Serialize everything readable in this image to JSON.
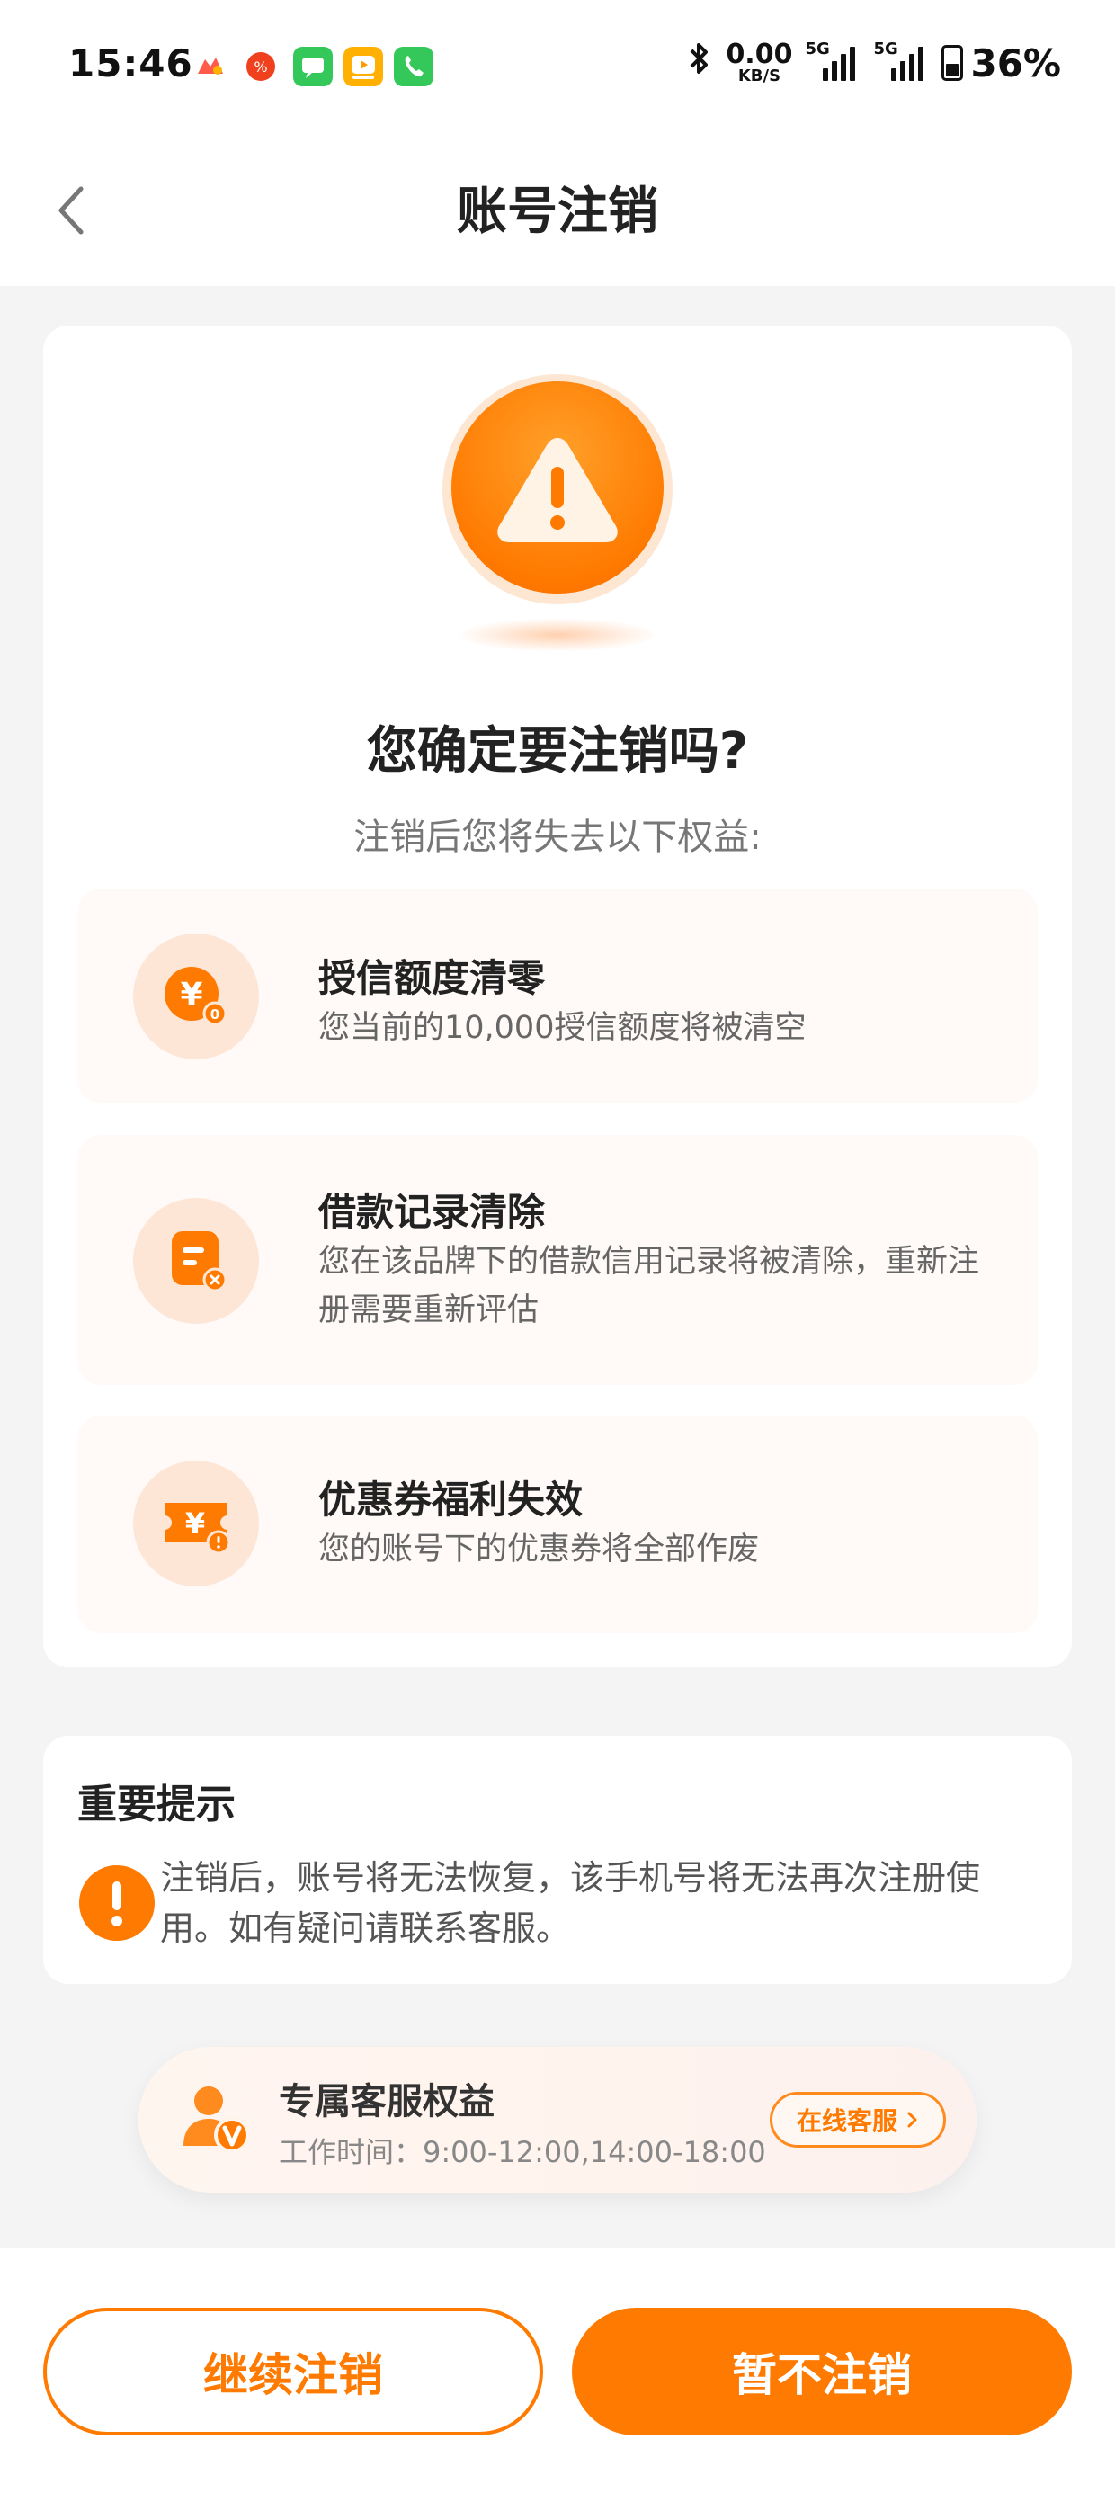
{
  "status_bar": {
    "time": "15:46",
    "net_speed_value": "0.00",
    "net_speed_unit": "KB/S",
    "signal_1_label": "5G",
    "signal_2_label": "5G",
    "battery_percent": "36%",
    "app_icons": [
      "game-icon",
      "promo-icon",
      "message-icon",
      "video-icon",
      "phone-icon"
    ],
    "bluetooth_icon": "bluetooth-icon"
  },
  "header": {
    "title": "账号注销",
    "back_icon": "chevron-left-icon"
  },
  "confirm": {
    "title": "您确定要注销吗?",
    "subtitle": "注销后您将失去以下权益:"
  },
  "benefits": [
    {
      "icon": "yen-coin-icon",
      "title": "授信额度清零",
      "desc": "您当前的10,000授信额度将被清空"
    },
    {
      "icon": "record-icon",
      "title": "借款记录清除",
      "desc": "您在该品牌下的借款信用记录将被清除，重新注册需要重新评估"
    },
    {
      "icon": "coupon-icon",
      "title": "优惠券福利失效",
      "desc": "您的账号下的优惠券将全部作废"
    }
  ],
  "notice": {
    "title": "重要提示",
    "text": "注销后，账号将无法恢复，该手机号将无法再次注册使用。如有疑问请联系客服。"
  },
  "customer_service": {
    "title": "专属客服权益",
    "hours": "工作时间：9:00-12:00,14:00-18:00",
    "button_label": "在线客服"
  },
  "actions": {
    "continue_label": "继续注销",
    "cancel_label": "暂不注销"
  },
  "colors": {
    "accent": "#ff7a00",
    "background": "#f4f4f5",
    "benefit_bg": "#fffaf7"
  }
}
